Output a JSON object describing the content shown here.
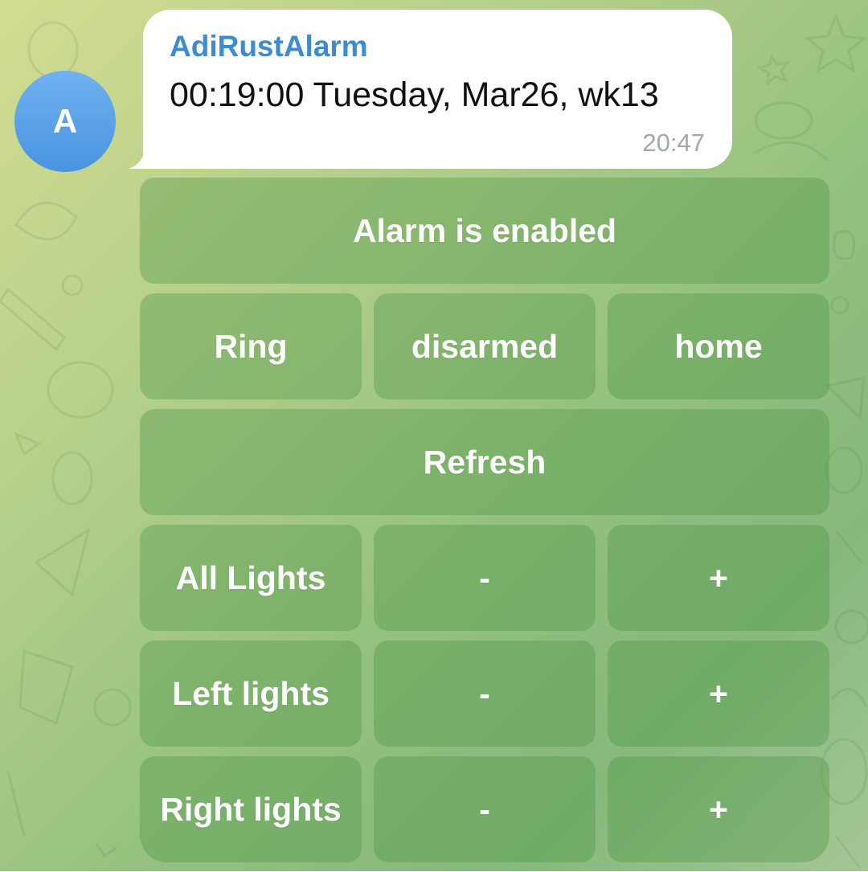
{
  "message": {
    "avatar_initial": "A",
    "sender": "AdiRustAlarm",
    "text": "00:19:00 Tuesday, Mar26, wk13",
    "time": "20:47"
  },
  "keyboard": {
    "rows": [
      [
        "Alarm is enabled"
      ],
      [
        "Ring",
        "disarmed",
        "home"
      ],
      [
        "Refresh"
      ],
      [
        "All Lights",
        "-",
        "+"
      ],
      [
        "Left lights",
        "-",
        "+"
      ],
      [
        "Right lights",
        "-",
        "+"
      ]
    ]
  },
  "colors": {
    "avatar": "#5aa3ea",
    "sender": "#3d8bd0",
    "button_text": "#ffffff"
  }
}
